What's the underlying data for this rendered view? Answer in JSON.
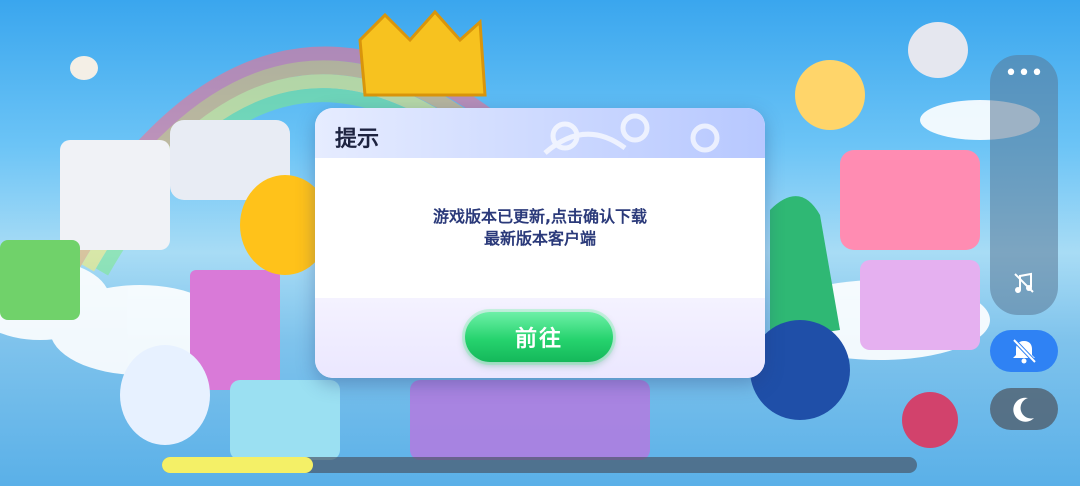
{
  "dialog": {
    "title": "提示",
    "message": "游戏版本已更新,点击确认下载最新版本客户端",
    "confirm_label": "前往"
  },
  "side_panel": {
    "more_icon": "more-horizontal-icon",
    "music_icon": "music-off-icon",
    "mute_icon": "notification-off-icon",
    "night_icon": "moon-icon"
  },
  "loading": {
    "progress": 0.2
  },
  "colors": {
    "primary_button": "#26d36e",
    "accent_blue": "#2f82f4",
    "progress": "#f4f067"
  }
}
